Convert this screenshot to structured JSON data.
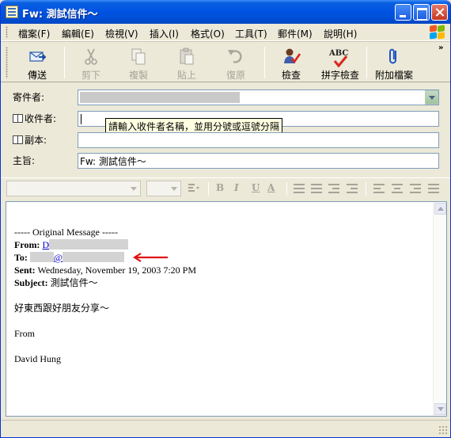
{
  "window": {
    "title": "Fw: 測試信件～"
  },
  "menu": {
    "items": [
      "檔案(F)",
      "編輯(E)",
      "檢視(V)",
      "插入(I)",
      "格式(O)",
      "工具(T)",
      "郵件(M)",
      "說明(H)"
    ]
  },
  "toolbar": {
    "send": "傳送",
    "cut": "剪下",
    "copy": "複製",
    "paste": "貼上",
    "undo": "復原",
    "check": "檢查",
    "spell": "拼字檢查",
    "spell_badge": "ABC",
    "attach": "附加檔案",
    "more": "»"
  },
  "fields": {
    "from_label": "寄件者:",
    "to_label": "收件者:",
    "cc_label": "副本:",
    "subject_label": "主旨:",
    "to_tooltip": "請輸入收件者名稱，並用分號或逗號分隔",
    "subject_value": "Fw: 測試信件～"
  },
  "formatbar": {
    "bold": "B",
    "italic": "I",
    "underline": "U",
    "font_color": "A"
  },
  "message": {
    "divider": "----- Original Message -----",
    "from_label": "From:",
    "from_value": "D",
    "to_label": "To:",
    "to_value": "@",
    "sent_label": "Sent:",
    "sent_value": "Wednesday, November 19, 2003 7:20 PM",
    "subject_label": "Subject:",
    "subject_value": "測試信件～",
    "body_line": "好東西跟好朋友分享～",
    "sign_from": "From",
    "sign_name": "David Hung"
  },
  "colors": {
    "titlebar": "#0054e3",
    "arrow": "#e01010",
    "link": "#0000cc"
  }
}
